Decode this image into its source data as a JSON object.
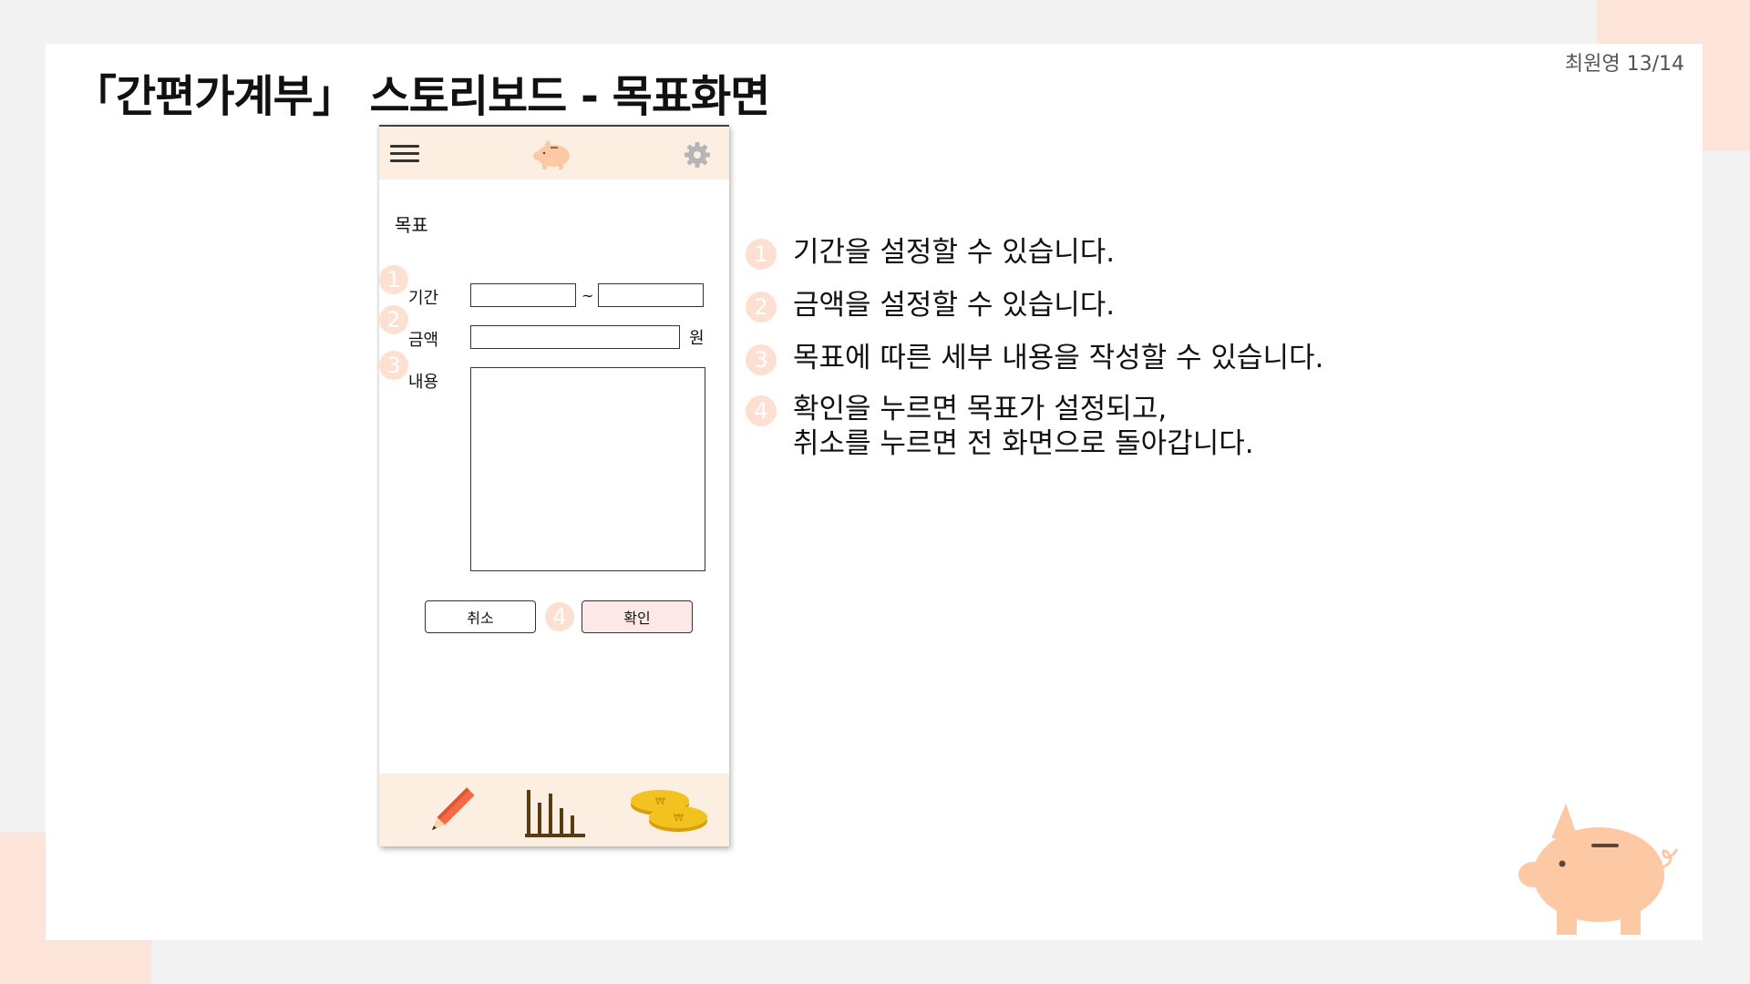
{
  "slide": {
    "title": "「간편가계부」 스토리보드 - 목표화면",
    "page_number": "최원영 13/14"
  },
  "phone": {
    "header": {
      "menu_icon": "hamburger-menu-icon",
      "logo_icon": "piggy-bank-icon",
      "settings_icon": "gear-icon"
    },
    "screen_title": "목표",
    "badges": [
      "1",
      "2",
      "3",
      "4"
    ],
    "fields": {
      "period_label": "기간",
      "period_separator": "~",
      "amount_label": "금액",
      "amount_unit": "원",
      "content_label": "내용"
    },
    "buttons": {
      "cancel": "취소",
      "confirm": "확인"
    },
    "bottom_nav": [
      "pencil-icon",
      "bar-chart-icon",
      "coins-icon"
    ]
  },
  "notes": [
    {
      "num": "1",
      "lines": [
        "기간을 설정할 수 있습니다."
      ]
    },
    {
      "num": "2",
      "lines": [
        "금액을 설정할 수 있습니다."
      ]
    },
    {
      "num": "3",
      "lines": [
        "목표에 따른 세부 내용을 작성할 수 있습니다."
      ]
    },
    {
      "num": "4",
      "lines": [
        "확인을 누르면  목표가 설정되고,",
        "취소를 누르면 전 화면으로 돌아갑니다."
      ]
    }
  ],
  "colors": {
    "accent_light": "#fde4d8",
    "phone_bar": "#fdeee2",
    "badge": "#fde0d2",
    "confirm_button": "#fde8e8",
    "pig": "#fcc9a4"
  }
}
